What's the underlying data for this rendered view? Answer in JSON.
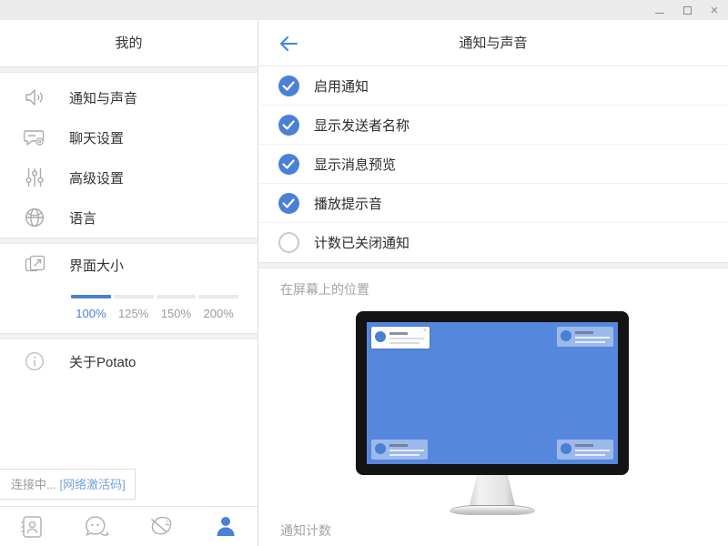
{
  "window": {
    "minimize": "minimize",
    "maximize": "maximize",
    "close": "×"
  },
  "sidebar": {
    "title": "我的",
    "items": [
      {
        "label": "通知与声音",
        "icon": "speaker-icon"
      },
      {
        "label": "聊天设置",
        "icon": "chat-settings-icon"
      },
      {
        "label": "高级设置",
        "icon": "sliders-icon"
      },
      {
        "label": "语言",
        "icon": "globe-icon"
      }
    ],
    "interface_size": {
      "label": "界面大小",
      "icon": "resize-icon",
      "options": [
        "100%",
        "125%",
        "150%",
        "200%"
      ],
      "selected": "100%"
    },
    "about": {
      "label": "关于Potato",
      "icon": "info-icon"
    },
    "status": {
      "connecting": "连接中...",
      "link": "[网络激活码]"
    },
    "nav": [
      {
        "name": "contacts",
        "active": false
      },
      {
        "name": "chats",
        "active": false
      },
      {
        "name": "discover",
        "active": false
      },
      {
        "name": "profile",
        "active": true
      }
    ]
  },
  "panel": {
    "title": "通知与声音",
    "toggles": [
      {
        "label": "启用通知",
        "checked": true
      },
      {
        "label": "显示发送者名称",
        "checked": true
      },
      {
        "label": "显示消息预览",
        "checked": true
      },
      {
        "label": "播放提示音",
        "checked": true
      },
      {
        "label": "计数已关闭通知",
        "checked": false
      }
    ],
    "position_section": {
      "label": "在屏幕上的位置",
      "selected_corner": "top-left"
    },
    "count_section": {
      "label": "通知计数"
    }
  },
  "colors": {
    "accent": "#4a80d6",
    "back_arrow": "#3d87e0",
    "screen_blue": "#5587dd",
    "titlebar": "#ebebeb",
    "icon_gray": "#a9a9a9"
  }
}
